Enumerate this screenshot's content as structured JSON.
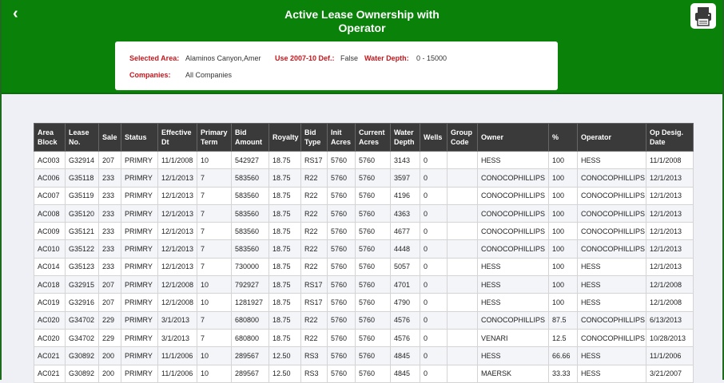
{
  "header": {
    "title_line1": "Active Lease Ownership with",
    "title_line2": "Operator",
    "back_icon": "‹",
    "accent": "#0a820a"
  },
  "filters": {
    "selected_area_label": "Selected Area:",
    "selected_area_value": "Alaminos Canyon,Amer",
    "use_def_label": "Use 2007-10 Def.:",
    "use_def_value": "False",
    "water_depth_label": "Water Depth:",
    "water_depth_value": "0 - 15000",
    "companies_label": "Companies:",
    "companies_value": "All Companies"
  },
  "table": {
    "headers": [
      [
        "Area",
        "Block"
      ],
      [
        "Lease",
        "No."
      ],
      [
        "Sale",
        ""
      ],
      [
        "Status",
        ""
      ],
      [
        "Effective",
        "Dt"
      ],
      [
        "Primary",
        "Term"
      ],
      [
        "Bid",
        "Amount"
      ],
      [
        "Royalty",
        ""
      ],
      [
        "Bid",
        "Type"
      ],
      [
        "Init",
        "Acres"
      ],
      [
        "Current",
        "Acres"
      ],
      [
        "Water",
        "Depth"
      ],
      [
        "Wells",
        ""
      ],
      [
        "Group",
        "Code"
      ],
      [
        "Owner",
        ""
      ],
      [
        "%",
        ""
      ],
      [
        "Operator",
        ""
      ],
      [
        "Op Desig.",
        "Date"
      ]
    ],
    "rows": [
      [
        "AC003",
        "G32914",
        "207",
        "PRIMRY",
        "11/1/2008",
        "10",
        "542927",
        "18.75",
        "RS17",
        "5760",
        "5760",
        "3143",
        "0",
        "",
        "HESS",
        "100",
        "HESS",
        "11/1/2008"
      ],
      [
        "AC006",
        "G35118",
        "233",
        "PRIMRY",
        "12/1/2013",
        "7",
        "583560",
        "18.75",
        "R22",
        "5760",
        "5760",
        "3597",
        "0",
        "",
        "CONOCOPHILLIPS",
        "100",
        "CONOCOPHILLIPS",
        "12/1/2013"
      ],
      [
        "AC007",
        "G35119",
        "233",
        "PRIMRY",
        "12/1/2013",
        "7",
        "583560",
        "18.75",
        "R22",
        "5760",
        "5760",
        "4196",
        "0",
        "",
        "CONOCOPHILLIPS",
        "100",
        "CONOCOPHILLIPS",
        "12/1/2013"
      ],
      [
        "AC008",
        "G35120",
        "233",
        "PRIMRY",
        "12/1/2013",
        "7",
        "583560",
        "18.75",
        "R22",
        "5760",
        "5760",
        "4363",
        "0",
        "",
        "CONOCOPHILLIPS",
        "100",
        "CONOCOPHILLIPS",
        "12/1/2013"
      ],
      [
        "AC009",
        "G35121",
        "233",
        "PRIMRY",
        "12/1/2013",
        "7",
        "583560",
        "18.75",
        "R22",
        "5760",
        "5760",
        "4677",
        "0",
        "",
        "CONOCOPHILLIPS",
        "100",
        "CONOCOPHILLIPS",
        "12/1/2013"
      ],
      [
        "AC010",
        "G35122",
        "233",
        "PRIMRY",
        "12/1/2013",
        "7",
        "583560",
        "18.75",
        "R22",
        "5760",
        "5760",
        "4448",
        "0",
        "",
        "CONOCOPHILLIPS",
        "100",
        "CONOCOPHILLIPS",
        "12/1/2013"
      ],
      [
        "AC014",
        "G35123",
        "233",
        "PRIMRY",
        "12/1/2013",
        "7",
        "730000",
        "18.75",
        "R22",
        "5760",
        "5760",
        "5057",
        "0",
        "",
        "HESS",
        "100",
        "HESS",
        "12/1/2013"
      ],
      [
        "AC018",
        "G32915",
        "207",
        "PRIMRY",
        "12/1/2008",
        "10",
        "792927",
        "18.75",
        "RS17",
        "5760",
        "5760",
        "4701",
        "0",
        "",
        "HESS",
        "100",
        "HESS",
        "12/1/2008"
      ],
      [
        "AC019",
        "G32916",
        "207",
        "PRIMRY",
        "12/1/2008",
        "10",
        "1281927",
        "18.75",
        "RS17",
        "5760",
        "5760",
        "4790",
        "0",
        "",
        "HESS",
        "100",
        "HESS",
        "12/1/2008"
      ],
      [
        "AC020",
        "G34702",
        "229",
        "PRIMRY",
        "3/1/2013",
        "7",
        "680800",
        "18.75",
        "R22",
        "5760",
        "5760",
        "4576",
        "0",
        "",
        "CONOCOPHILLIPS",
        "87.5",
        "CONOCOPHILLIPS",
        "6/13/2013"
      ],
      [
        "AC020",
        "G34702",
        "229",
        "PRIMRY",
        "3/1/2013",
        "7",
        "680800",
        "18.75",
        "R22",
        "5760",
        "5760",
        "4576",
        "0",
        "",
        "VENARI",
        "12.5",
        "CONOCOPHILLIPS",
        "10/28/2013"
      ],
      [
        "AC021",
        "G30892",
        "200",
        "PRIMRY",
        "11/1/2006",
        "10",
        "289567",
        "12.50",
        "RS3",
        "5760",
        "5760",
        "4845",
        "0",
        "",
        "HESS",
        "66.66",
        "HESS",
        "11/1/2006"
      ],
      [
        "AC021",
        "G30892",
        "200",
        "PRIMRY",
        "11/1/2006",
        "10",
        "289567",
        "12.50",
        "RS3",
        "5760",
        "5760",
        "4845",
        "0",
        "",
        "MAERSK",
        "33.33",
        "HESS",
        "3/21/2007"
      ]
    ]
  }
}
